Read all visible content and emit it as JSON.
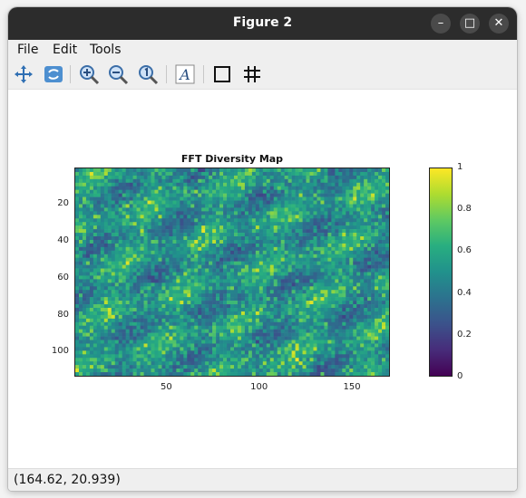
{
  "window": {
    "title": "Figure 2"
  },
  "menu": {
    "file": "File",
    "edit": "Edit",
    "tools": "Tools"
  },
  "toolbar": {
    "icons": [
      "pan-icon",
      "rotate-icon",
      "zoom-in-icon",
      "zoom-out-icon",
      "zoom-reset-icon",
      "insert-text-icon",
      "toggle-axes-box-icon",
      "toggle-grid-icon"
    ]
  },
  "status": {
    "coords": "(164.62, 20.939)"
  },
  "chart_data": {
    "type": "heatmap",
    "title": "FFT Diversity Map",
    "xlabel": "",
    "ylabel": "",
    "x_range": [
      0.5,
      170.5
    ],
    "y_range": [
      0.5,
      113.5
    ],
    "y_reversed": true,
    "x_ticks": [
      50,
      100,
      150
    ],
    "y_ticks": [
      20,
      40,
      60,
      80,
      100
    ],
    "colorbar": {
      "range": [
        0,
        1
      ],
      "ticks": [
        "0",
        "0.2",
        "0.4",
        "0.6",
        "0.8",
        "1"
      ],
      "colormap": "viridis"
    },
    "grid": false,
    "values_note_visible": false
  }
}
